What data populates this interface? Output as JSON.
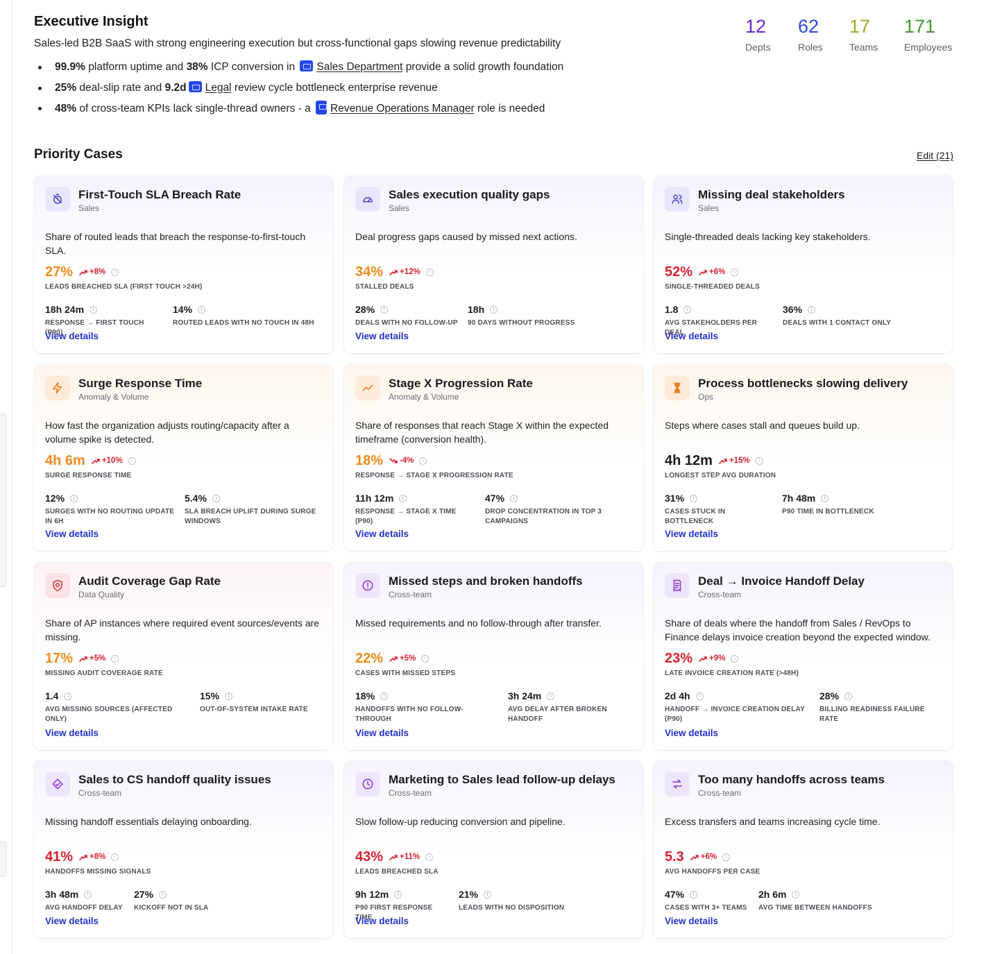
{
  "executive": {
    "title": "Executive Insight",
    "summary": "Sales-led B2B SaaS with strong engineering execution but cross-functional gaps slowing revenue predictability",
    "bullet1": {
      "b1": "99.9%",
      "t1": " platform uptime and ",
      "b2": "38%",
      "t2": " ICP conversion in ",
      "link": "Sales Department",
      "t3": " provide a solid growth foundation"
    },
    "bullet2": {
      "b1": "25%",
      "t1": " deal-slip rate and ",
      "b2": "9.2d",
      "link": "Legal",
      "t3": " review cycle bottleneck enterprise revenue"
    },
    "bullet3": {
      "b1": "48%",
      "t1": " of cross-team KPIs lack single-thread owners - a ",
      "link": "Revenue Operations Manager",
      "t3": " role is needed"
    }
  },
  "stats": [
    {
      "value": "12",
      "label": "Depts",
      "color": "#6b25d6"
    },
    {
      "value": "62",
      "label": "Roles",
      "color": "#2b46e0"
    },
    {
      "value": "17",
      "label": "Teams",
      "color": "#a9a62a"
    },
    {
      "value": "171",
      "label": "Employees",
      "color": "#3c9a2c"
    }
  ],
  "priority": {
    "title": "Priority Cases",
    "edit_label": "Edit (21)"
  },
  "view_details_label": "View details",
  "cards": [
    {
      "title": "First-Touch SLA Breach Rate",
      "category": "Sales",
      "icon": "timer-off-icon",
      "desc": "Share of routed leads that breach the response-to-first-touch SLA.",
      "value": "27%",
      "trend": "+8%",
      "trend_dir": "up",
      "metric_label": "Leads breached SLA (first touch >24h)",
      "sub1": {
        "value": "18h 24m",
        "label": "Response → first touch (P90)"
      },
      "sub2": {
        "value": "14%",
        "label": "Routed leads with no touch in 48h"
      }
    },
    {
      "title": "Sales execution quality gaps",
      "category": "Sales",
      "icon": "gauge-icon",
      "desc": "Deal progress gaps caused by missed next actions.",
      "value": "34%",
      "trend": "+12%",
      "trend_dir": "up",
      "metric_label": "Stalled deals",
      "sub1": {
        "value": "28%",
        "label": "Deals with no follow-up"
      },
      "sub2": {
        "value": "18h",
        "label": "90 days without progress"
      }
    },
    {
      "title": "Missing deal stakeholders",
      "category": "Sales",
      "icon": "users-icon",
      "desc": "Single-threaded deals lacking key stakeholders.",
      "value": "52%",
      "trend": "+6%",
      "trend_dir": "up",
      "metric_label": "Single-threaded deals",
      "sub1": {
        "value": "1.8",
        "label": "Avg stakeholders per deal"
      },
      "sub2": {
        "value": "36%",
        "label": "Deals with 1 contact only"
      }
    },
    {
      "title": "Surge Response Time",
      "category": "Anomaly & Volume",
      "icon": "lightning-icon",
      "desc": "How fast the organization adjusts routing/capacity after a volume spike is detected.",
      "value": "4h 6m",
      "trend": "+10%",
      "trend_dir": "up",
      "metric_label": "Surge response time",
      "sub1": {
        "value": "12%",
        "label": "Surges with no routing update in 6h"
      },
      "sub2": {
        "value": "5.4%",
        "label": "SLA breach uplift during surge windows"
      }
    },
    {
      "title": "Stage X Progression Rate",
      "category": "Anomaly & Volume",
      "icon": "trend-line-icon",
      "desc": "Share of responses that reach Stage X within the expected timeframe (conversion health).",
      "value": "18%",
      "trend": "-4%",
      "trend_dir": "down",
      "metric_label": "Response → Stage X progression rate",
      "sub1": {
        "value": "11h 12m",
        "label": "Response → Stage X time (P90)"
      },
      "sub2": {
        "value": "47%",
        "label": "Drop concentration in top 3 campaigns"
      }
    },
    {
      "title": "Process bottlenecks slowing delivery",
      "category": "Ops",
      "icon": "hourglass-icon",
      "desc": "Steps where cases stall and queues build up.",
      "value": "4h 12m",
      "trend": "+15%",
      "trend_dir": "up",
      "metric_label": "Longest step avg duration",
      "sub1": {
        "value": "31%",
        "label": "Cases stuck in bottleneck"
      },
      "sub2": {
        "value": "7h 48m",
        "label": "P90 time in bottleneck"
      }
    },
    {
      "title": "Audit Coverage Gap Rate",
      "category": "Data Quality",
      "icon": "shield-alert-icon",
      "desc": "Share of AP instances where required event sources/events are missing.",
      "value": "17%",
      "trend": "+5%",
      "trend_dir": "up",
      "metric_label": "Missing audit coverage rate",
      "sub1": {
        "value": "1.4",
        "label": "Avg missing sources (affected only)"
      },
      "sub2": {
        "value": "15%",
        "label": "Out-of-system intake rate"
      }
    },
    {
      "title": "Missed steps and broken handoffs",
      "category": "Cross-team",
      "icon": "alert-circle-icon",
      "desc": "Missed requirements and no follow-through after transfer.",
      "value": "22%",
      "trend": "+5%",
      "trend_dir": "up",
      "metric_label": "Cases with missed steps",
      "sub1": {
        "value": "18%",
        "label": "Handoffs with no follow-through"
      },
      "sub2": {
        "value": "3h 24m",
        "label": "Avg delay after broken handoff"
      }
    },
    {
      "title": "Deal → Invoice Handoff Delay",
      "category": "Cross-team",
      "icon": "invoice-icon",
      "desc": "Share of deals where the handoff from Sales / RevOps to Finance delays invoice creation beyond the expected window.",
      "value": "23%",
      "trend": "+9%",
      "trend_dir": "up",
      "metric_label": "Late invoice creation rate (>48h)",
      "sub1": {
        "value": "2d 4h",
        "label": "Handoff → invoice creation delay (P90)"
      },
      "sub2": {
        "value": "28%",
        "label": "Billing readiness failure rate"
      }
    },
    {
      "title": "Sales to CS handoff quality issues",
      "category": "Cross-team",
      "icon": "handshake-icon",
      "desc": "Missing handoff essentials delaying onboarding.",
      "value": "41%",
      "trend": "+8%",
      "trend_dir": "up",
      "metric_label": "Handoffs missing signals",
      "sub1": {
        "value": "3h 48m",
        "label": "Avg handoff delay"
      },
      "sub2": {
        "value": "27%",
        "label": "Kickoff not in SLA"
      }
    },
    {
      "title": "Marketing to Sales lead follow-up delays",
      "category": "Cross-team",
      "icon": "clock-icon",
      "desc": "Slow follow-up reducing conversion and pipeline.",
      "value": "43%",
      "trend": "+11%",
      "trend_dir": "up",
      "metric_label": "Leads breached SLA",
      "sub1": {
        "value": "9h 12m",
        "label": "P90 first response time"
      },
      "sub2": {
        "value": "21%",
        "label": "Leads with no disposition"
      }
    },
    {
      "title": "Too many handoffs across teams",
      "category": "Cross-team",
      "icon": "arrows-swap-icon",
      "desc": "Excess transfers and teams increasing cycle time.",
      "value": "5.3",
      "trend": "+6%",
      "trend_dir": "up",
      "metric_label": "Avg handoffs per case",
      "sub1": {
        "value": "47%",
        "label": "Cases with 3+ teams"
      },
      "sub2": {
        "value": "2h 6m",
        "label": "Avg time between handoffs"
      }
    }
  ]
}
